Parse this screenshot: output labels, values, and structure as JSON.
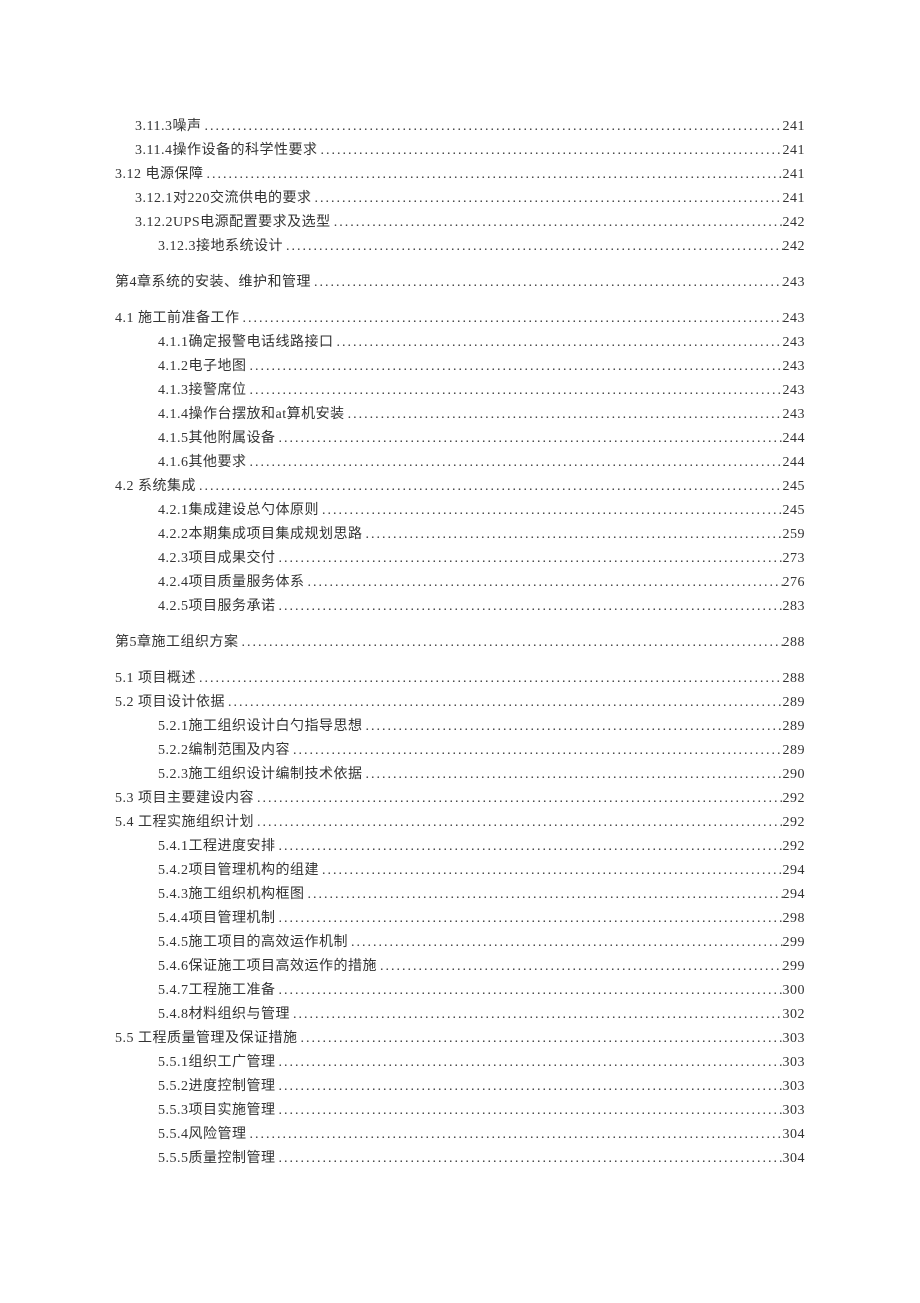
{
  "toc": [
    {
      "level": 1,
      "label": "3.11.3噪声",
      "page": "241"
    },
    {
      "level": 1,
      "label": "3.11.4操作设备的科学性要求 ",
      "page": "241"
    },
    {
      "level": 0,
      "label": "3.12 电源保障",
      "page": "241"
    },
    {
      "level": 1,
      "label": "3.12.1对220交流供电的要求 ",
      "page": " 241"
    },
    {
      "level": 1,
      "label": "3.12.2UPS电源配置要求及选型 ",
      "page": "242"
    },
    {
      "level": 2,
      "label": "3.12.3接地系统设计",
      "page": "242"
    },
    {
      "level": 0,
      "label": "第4章系统的安装、维护和管理 ",
      "page": "243",
      "before": 12,
      "after": 12
    },
    {
      "level": 0,
      "label": "4.1 施工前准备工作 ",
      "page": "243"
    },
    {
      "level": 2,
      "label": "4.1.1确定报警电话线路接口 ",
      "page": " 243"
    },
    {
      "level": 2,
      "label": "4.1.2电子地图",
      "page": "243"
    },
    {
      "level": 2,
      "label": "4.1.3接警席位",
      "page": "243"
    },
    {
      "level": 2,
      "label": "4.1.4操作台摆放和at算机安装 ",
      "page": "243"
    },
    {
      "level": 2,
      "label": "4.1.5其他附属设备",
      "page": "244"
    },
    {
      "level": 2,
      "label": "4.1.6其他要求",
      "page": "244"
    },
    {
      "level": 0,
      "label": "4.2 系统集成",
      "page": "245"
    },
    {
      "level": 2,
      "label": "4.2.1集成建设总勺体原则 ",
      "page": "245"
    },
    {
      "level": 2,
      "label": "4.2.2本期集成项目集成规划思路 ",
      "page": "259"
    },
    {
      "level": 2,
      "label": "4.2.3项目成果交付",
      "page": "273"
    },
    {
      "level": 2,
      "label": "4.2.4项目质量服务体系 ",
      "page": "276"
    },
    {
      "level": 2,
      "label": "4.2.5项目服务承诺",
      "page": "283"
    },
    {
      "level": 0,
      "label": "第5章施工组织方案 ",
      "page": "288",
      "before": 12,
      "after": 12
    },
    {
      "level": 0,
      "label": "5.1 项目概述",
      "page": "288"
    },
    {
      "level": 0,
      "label": "5.2 项目设计依据 ",
      "page": "289"
    },
    {
      "level": 2,
      "label": "5.2.1施工组织设计白勺指导思想 ",
      "page": "289"
    },
    {
      "level": 2,
      "label": "5.2.2编制范围及内容",
      "page": "289"
    },
    {
      "level": 2,
      "label": "5.2.3施工组织设计编制技术依据 ",
      "page": "290"
    },
    {
      "level": 0,
      "label": "5.3 项目主要建设内容 ",
      "page": " 292"
    },
    {
      "level": 0,
      "label": "5.4 工程实施组织计划 ",
      "page": "292"
    },
    {
      "level": 2,
      "label": "5.4.1工程进度安排 ",
      "page": "292"
    },
    {
      "level": 2,
      "label": "5.4.2项目管理机构的组建 ",
      "page": "294"
    },
    {
      "level": 2,
      "label": "5.4.3施工组织机构框图 ",
      "page": "294"
    },
    {
      "level": 2,
      "label": "5.4.4项目管理机制",
      "page": "298"
    },
    {
      "level": 2,
      "label": "5.4.5施工项目的高效运作机制 ",
      "page": "299"
    },
    {
      "level": 2,
      "label": "5.4.6保证施工项目高效运作的措施 ",
      "page": "299"
    },
    {
      "level": 2,
      "label": "5.4.7工程施工准备",
      "page": "300"
    },
    {
      "level": 2,
      "label": "5.4.8材料组织与管理 ",
      "page": "302"
    },
    {
      "level": 0,
      "label": "5.5 工程质量管理及保证措施 ",
      "page": "303"
    },
    {
      "level": 2,
      "label": "5.5.1组织工广管理",
      "page": "303"
    },
    {
      "level": 2,
      "label": "5.5.2进度控制管理",
      "page": "303"
    },
    {
      "level": 2,
      "label": "5.5.3项目实施管理",
      "page": "303"
    },
    {
      "level": 2,
      "label": "5.5.4风险管理",
      "page": "304"
    },
    {
      "level": 2,
      "label": "5.5.5质量控制管理",
      "page": "304"
    }
  ]
}
